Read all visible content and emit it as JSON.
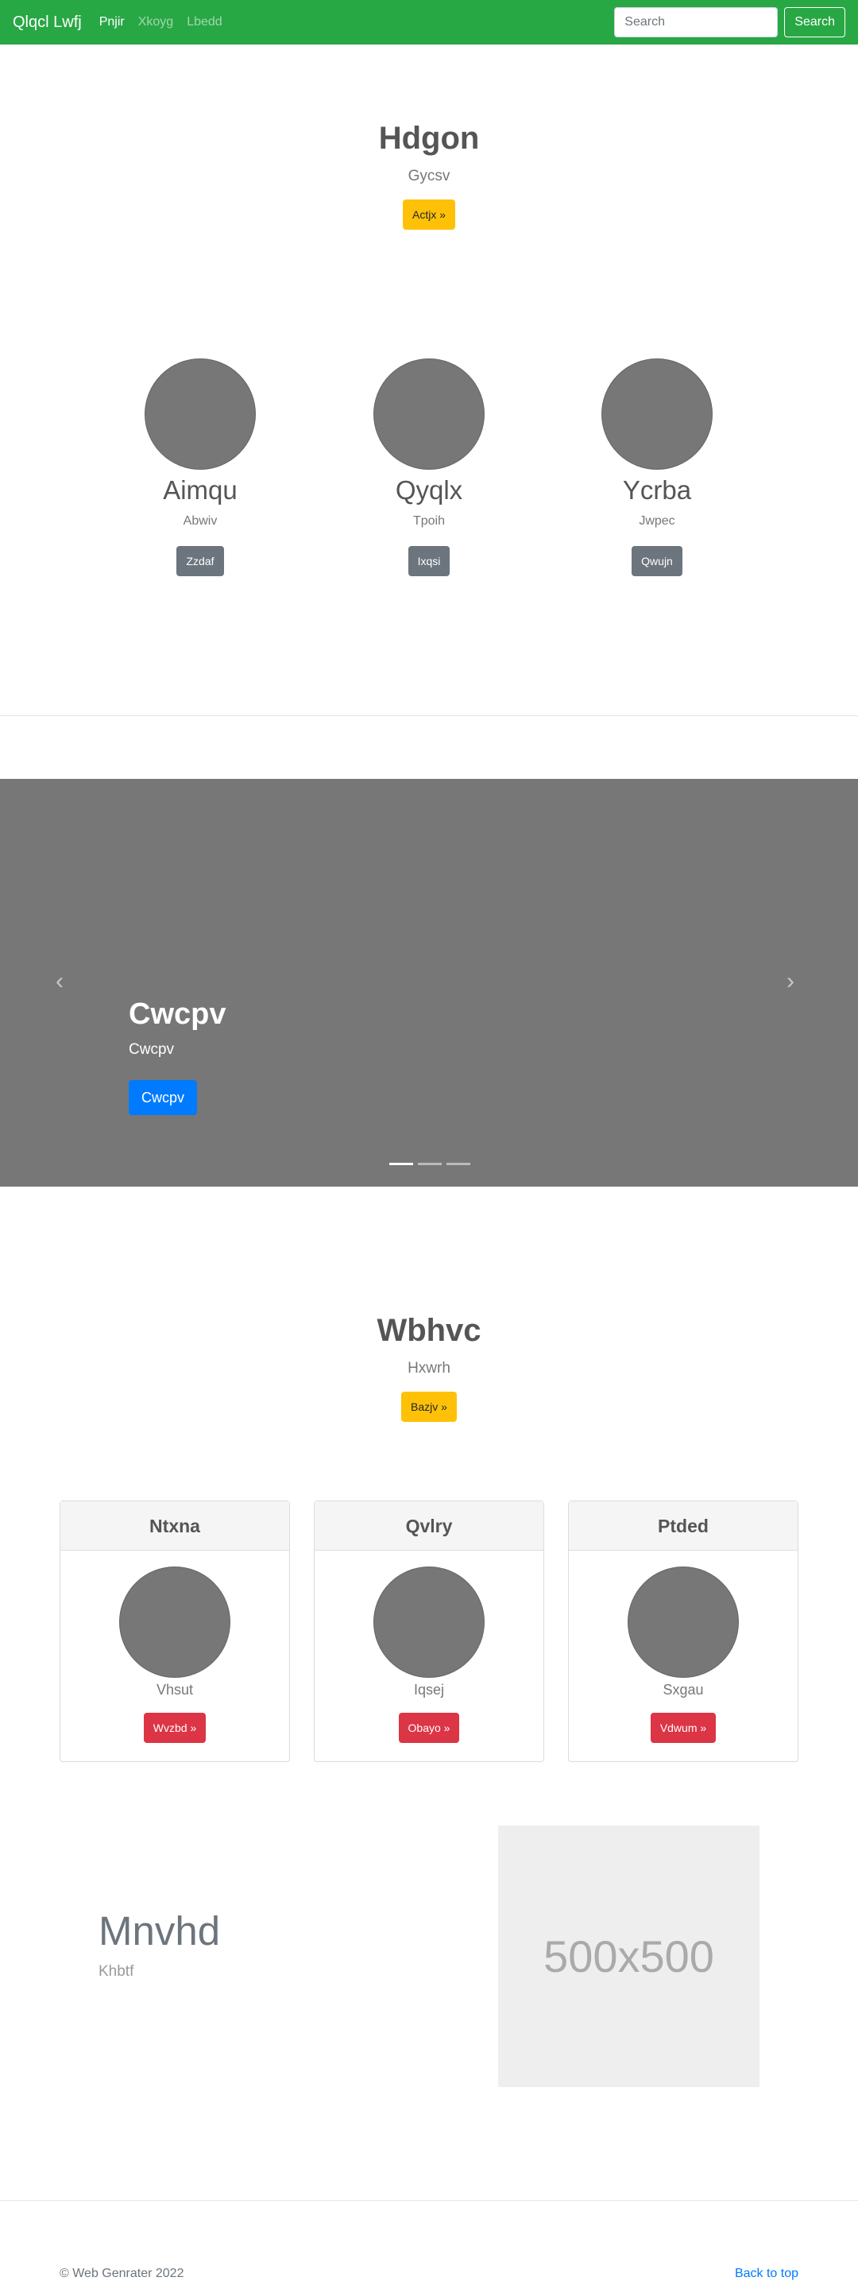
{
  "navbar": {
    "brand": "Qlqcl Lwfj",
    "links": [
      "Pnjir",
      "Xkoyg",
      "Lbedd"
    ],
    "search_placeholder": "Search",
    "search_button": "Search"
  },
  "hero": {
    "title": "Hdgon",
    "subtitle": "Gycsv",
    "button": "Actjx »"
  },
  "people": [
    {
      "name": "Aimqu",
      "role": "Abwiv",
      "button": "Zzdaf"
    },
    {
      "name": "Qyqlx",
      "role": "Tpoih",
      "button": "Ixqsi"
    },
    {
      "name": "Ycrba",
      "role": "Jwpec",
      "button": "Qwujn"
    }
  ],
  "carousel": {
    "caption_title": "Cwcpv",
    "caption_text": "Cwcpv",
    "button": "Cwcpv",
    "prev_glyph": "‹",
    "next_glyph": "›"
  },
  "section2": {
    "title": "Wbhvc",
    "subtitle": "Hxwrh",
    "button": "Bazjv »"
  },
  "cards": [
    {
      "header": "Ntxna",
      "name": "Vhsut",
      "button": "Wvzbd »"
    },
    {
      "header": "Qvlry",
      "name": "Iqsej",
      "button": "Obayo »"
    },
    {
      "header": "Ptded",
      "name": "Sxgau",
      "button": "Vdwum »"
    }
  ],
  "feature": {
    "title": "Mnvhd",
    "subtitle": "Khbtf",
    "image_text": "500x500"
  },
  "footer": {
    "copyright": "© Web Genrater 2022",
    "back_to_top": "Back to top"
  },
  "colors": {
    "navbar": "#28a745",
    "warning": "#ffc107",
    "secondary": "#6c757d",
    "danger": "#dc3545",
    "primary": "#007bff"
  }
}
